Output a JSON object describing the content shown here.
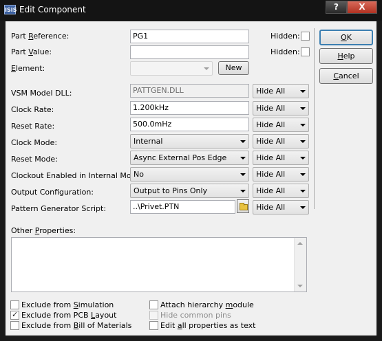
{
  "window": {
    "title": "Edit Component",
    "icon_text": "ISIS",
    "help_glyph": "?",
    "close_glyph": "X"
  },
  "part_reference": {
    "label_pre": "Part ",
    "label_u": "R",
    "label_post": "eference:",
    "value": "PG1"
  },
  "part_value": {
    "label_pre": "Part ",
    "label_u": "V",
    "label_post": "alue:",
    "value": ""
  },
  "element": {
    "label_u": "E",
    "label_post": "lement:",
    "value": "",
    "new_label": "New"
  },
  "hidden_label": "Hidden:",
  "rows": [
    {
      "label": "VSM Model DLL:",
      "value": "PATTGEN.DLL",
      "kind": "readonly",
      "vis": "Hide All"
    },
    {
      "label": "Clock Rate:",
      "value": "1.200kHz",
      "kind": "text",
      "vis": "Hide All"
    },
    {
      "label": "Reset Rate:",
      "value": "500.0mHz",
      "kind": "text",
      "vis": "Hide All"
    },
    {
      "label": "Clock Mode:",
      "value": "Internal",
      "kind": "combo",
      "vis": "Hide All"
    },
    {
      "label": "Reset Mode:",
      "value": "Async External Pos Edge",
      "kind": "combo",
      "vis": "Hide All"
    },
    {
      "label": "Clockout Enabled in Internal Mode:",
      "value": "No",
      "kind": "combo",
      "vis": "Hide All"
    },
    {
      "label": "Output Configuration:",
      "value": "Output to Pins Only",
      "kind": "combo",
      "vis": "Hide All"
    },
    {
      "label": "Pattern Generator Script:",
      "value": "..\\Privet.PTN",
      "kind": "file",
      "vis": "Hide All"
    }
  ],
  "other_properties": {
    "label_pre": "Other ",
    "label_u": "P",
    "label_post": "roperties:",
    "value": ""
  },
  "buttons": {
    "ok": {
      "u": "O",
      "post": "K"
    },
    "help": {
      "u": "H",
      "post": "elp"
    },
    "cancel": {
      "u": "C",
      "post": "ancel"
    }
  },
  "checkboxes": {
    "exclude_simulation": {
      "pre": "Exclude from ",
      "u": "S",
      "post": "imulation",
      "checked": false
    },
    "exclude_pcb": {
      "pre": "Exclude from PCB ",
      "u": "L",
      "post": "ayout",
      "checked": true
    },
    "exclude_bom": {
      "pre": "Exclude from ",
      "u": "B",
      "post": "ill of Materials",
      "checked": false
    },
    "attach_hierarchy": {
      "pre": "Attach hierarchy ",
      "u": "m",
      "post": "odule",
      "checked": false
    },
    "hide_common_pins": {
      "pre": "Hide common pins",
      "u": "",
      "post": "",
      "checked": false,
      "disabled": true
    },
    "edit_all_text": {
      "pre": "Edit ",
      "u": "a",
      "post": "ll properties as text",
      "checked": false
    }
  }
}
